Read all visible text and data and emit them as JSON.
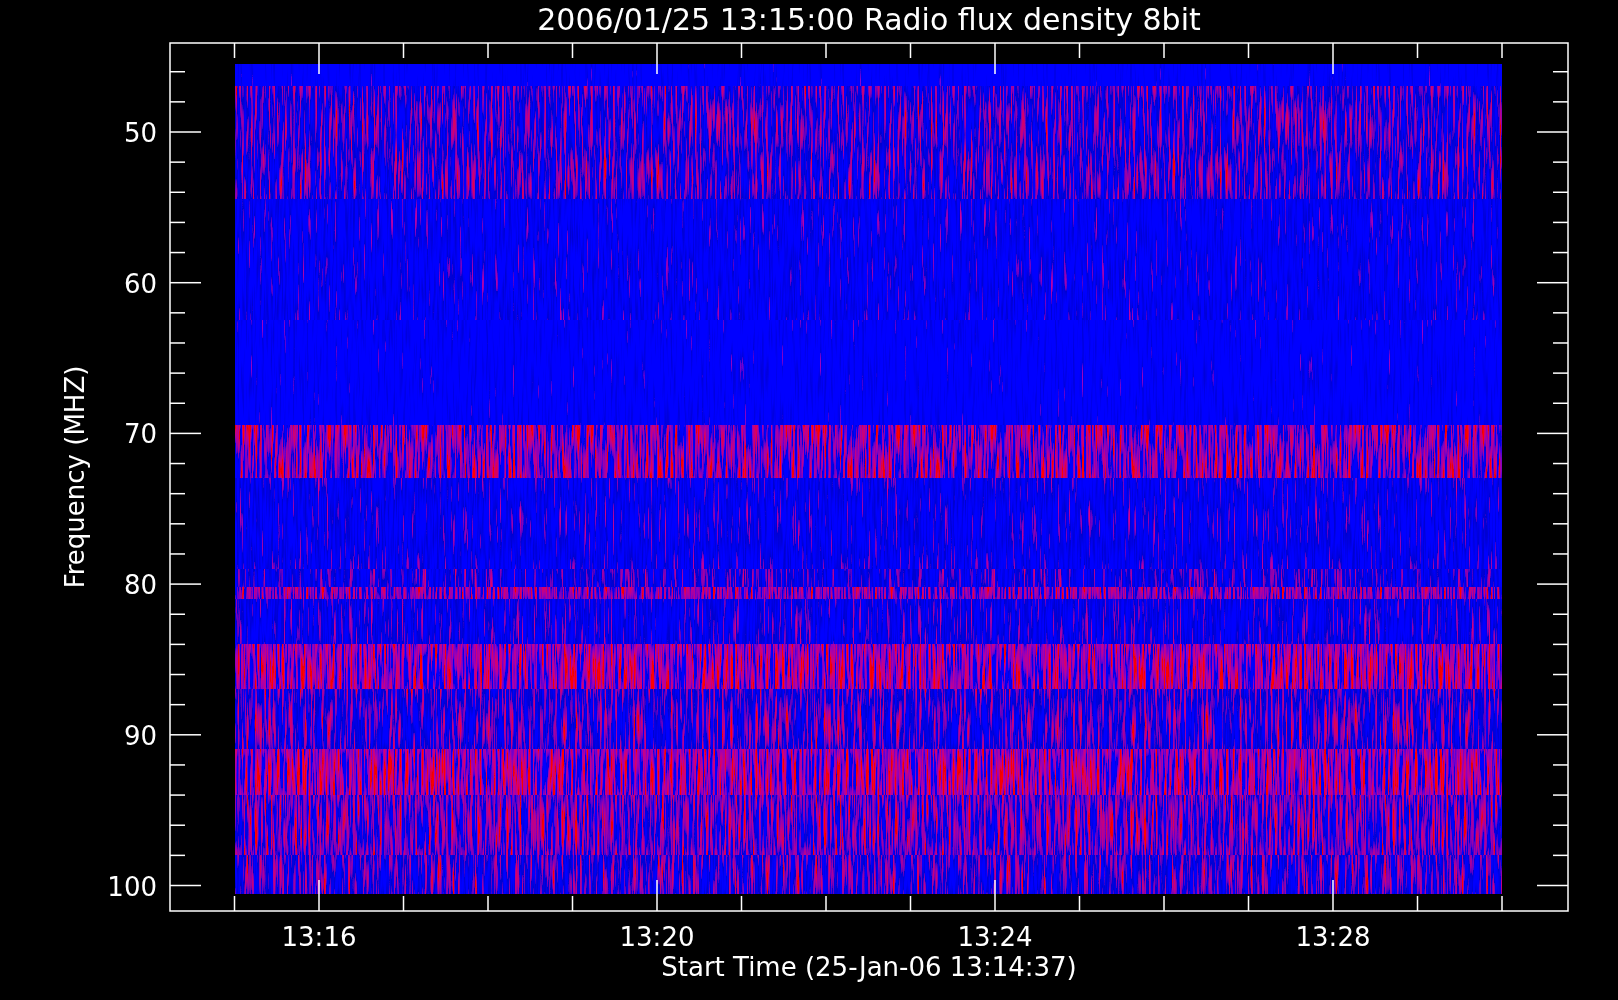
{
  "plot": {
    "title": "2006/01/25 13:15:00 Radio flux density 8bit",
    "ylabel": "Frequency (MHZ)",
    "xlabel": "Start Time (25-Jan-06 13:14:37)",
    "y_tick_labels": [
      "50",
      "60",
      "70",
      "80",
      "90",
      "100"
    ],
    "x_tick_labels": [
      "13:16",
      "13:20",
      "13:24",
      "13:28"
    ]
  }
}
